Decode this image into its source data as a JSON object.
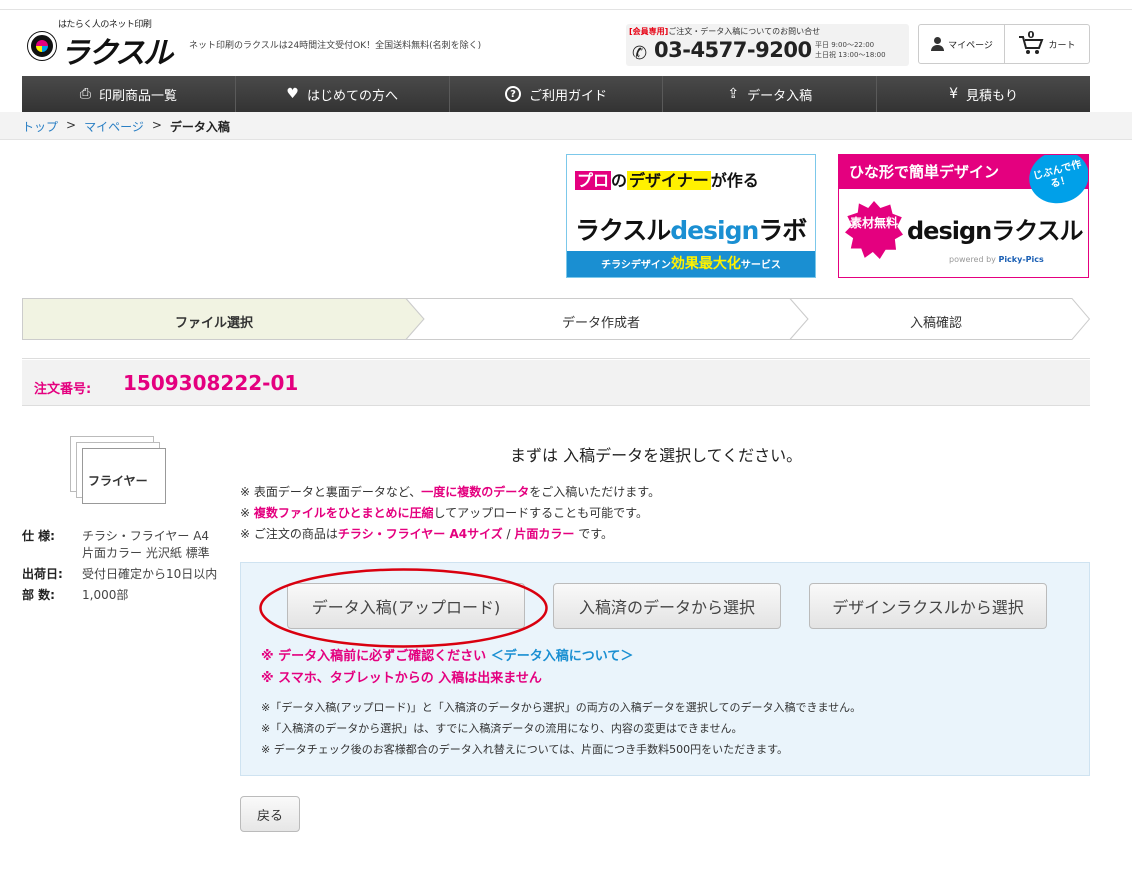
{
  "header": {
    "logo_tagline": "はたらく人のネット印刷",
    "logo_text": "ラクスル",
    "tagline": "ネット印刷のラクスルは24時間注文受付OK！全国送料無料(名刺を除く)",
    "contact_badge": "[会員専用]",
    "contact_note": "ご注文・データ入稿についてのお問い合せ",
    "phone": "03-4577-9200",
    "hours_weekday": "平日 9:00〜22:00",
    "hours_weekend": "土日祝 13:00〜18:00",
    "mypage": "マイページ",
    "cart": "カート",
    "cart_count": "0"
  },
  "nav": [
    {
      "label": "印刷商品一覧",
      "icon": "printer-icon",
      "glyph": "⎙"
    },
    {
      "label": "はじめての方へ",
      "icon": "heart-icon",
      "glyph": "♥"
    },
    {
      "label": "ご利用ガイド",
      "icon": "question-icon",
      "glyph": "?"
    },
    {
      "label": "データ入稿",
      "icon": "upload-icon",
      "glyph": "⇪"
    },
    {
      "label": "見積もり",
      "icon": "yen-icon",
      "glyph": "¥"
    }
  ],
  "breadcrumb": {
    "top": "トップ",
    "sep": ">",
    "mypage": "マイページ",
    "current": "データ入稿"
  },
  "banners": {
    "lab_pro": "プロ",
    "lab_no": "の",
    "lab_designer": "デザイナー",
    "lab_tsukuru": "が作る",
    "lab_title_a": "ラクスル",
    "lab_title_b": "design",
    "lab_title_c": "ラボ",
    "lab_sub_a": "チラシデザイン",
    "lab_sub_b": "効果最大化",
    "lab_sub_c": "サービス",
    "online_top": "ひな形で簡単デザイン",
    "online_bubble": "じぶんで作る！",
    "online_badge": "素材無料",
    "online_title": "designラクスル",
    "online_powered": "powered by",
    "online_powered_brand": "Picky-Pics"
  },
  "steps": [
    "ファイル選択",
    "データ作成者",
    "入稿確認"
  ],
  "order": {
    "label": "注文番号:",
    "number": "1509308222-01"
  },
  "product": {
    "image_label": "フライヤー",
    "spec_key": "仕 様:",
    "spec_value": "チラシ・フライヤー A4 片面カラー 光沢紙 標準",
    "ship_key": "出荷日:",
    "ship_value": "受付日確定から10日以内",
    "qty_key": "部 数:",
    "qty_value": "1,000部"
  },
  "main": {
    "heading": "まずは 入稿データを選択してください。",
    "note1_a": "※ 表面データと裏面データなど、",
    "note1_b": "一度に複数のデータ",
    "note1_c": "をご入稿いただけます。",
    "note2_a": "※ ",
    "note2_b": "複数ファイルをひとまとめに圧縮",
    "note2_c": "してアップロードすることも可能です。",
    "note3_a": "※ ご注文の商品は",
    "note3_b": "チラシ・フライヤー A4サイズ",
    "note3_c": " / ",
    "note3_d": "片面カラー",
    "note3_e": " です。"
  },
  "panel": {
    "btn_upload": "データ入稿(アップロード)",
    "btn_existing": "入稿済のデータから選択",
    "btn_design": "デザインラクスルから選択",
    "warn1": "※ データ入稿前に必ずご確認ください",
    "warn1_link": "＜データ入稿について＞",
    "warn2": "※ スマホ、タブレットからの 入稿は出来ません",
    "small1": "※「データ入稿(アップロード)」と「入稿済のデータから選択」の両方の入稿データを選択してのデータ入稿できません。",
    "small2": "※「入稿済のデータから選択」は、すでに入稿済データの流用になり、内容の変更はできません。",
    "small3": "※ データチェック後のお客様都合のデータ入れ替えについては、片面につき手数料500円をいただきます。"
  },
  "back": "戻る",
  "colors": {
    "accent": "#e4007f",
    "link": "#2a7fc4",
    "panel_bg": "#eaf4fb",
    "annotation": "#d9000f"
  }
}
